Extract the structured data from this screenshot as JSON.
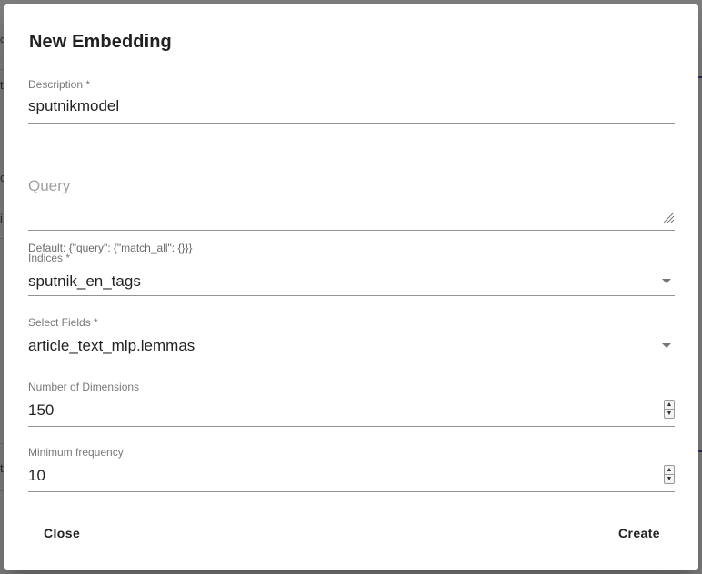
{
  "dialog": {
    "title": "New Embedding",
    "description": {
      "label": "Description *",
      "value": "sputnikmodel"
    },
    "query": {
      "label": "Query",
      "helper": "Default: {\"query\": {\"match_all\": {}}}"
    },
    "indices": {
      "label": "Indices *",
      "value": "sputnik_en_tags"
    },
    "fields": {
      "label": "Select Fields *",
      "value": "article_text_mlp.lemmas"
    },
    "dimensions": {
      "label": "Number of Dimensions",
      "value": "150"
    },
    "min_frequency": {
      "label": "Minimum frequency",
      "value": "10"
    },
    "actions": {
      "close_label": "Close",
      "create_label": "Create"
    }
  },
  "background": {
    "row_chars": [
      "c",
      "t",
      "c",
      "i",
      "t"
    ]
  },
  "icons": {
    "select_caret": "caret-down-icon",
    "spinner": "number-spinner-icon",
    "resize": "resize-grip-icon"
  }
}
